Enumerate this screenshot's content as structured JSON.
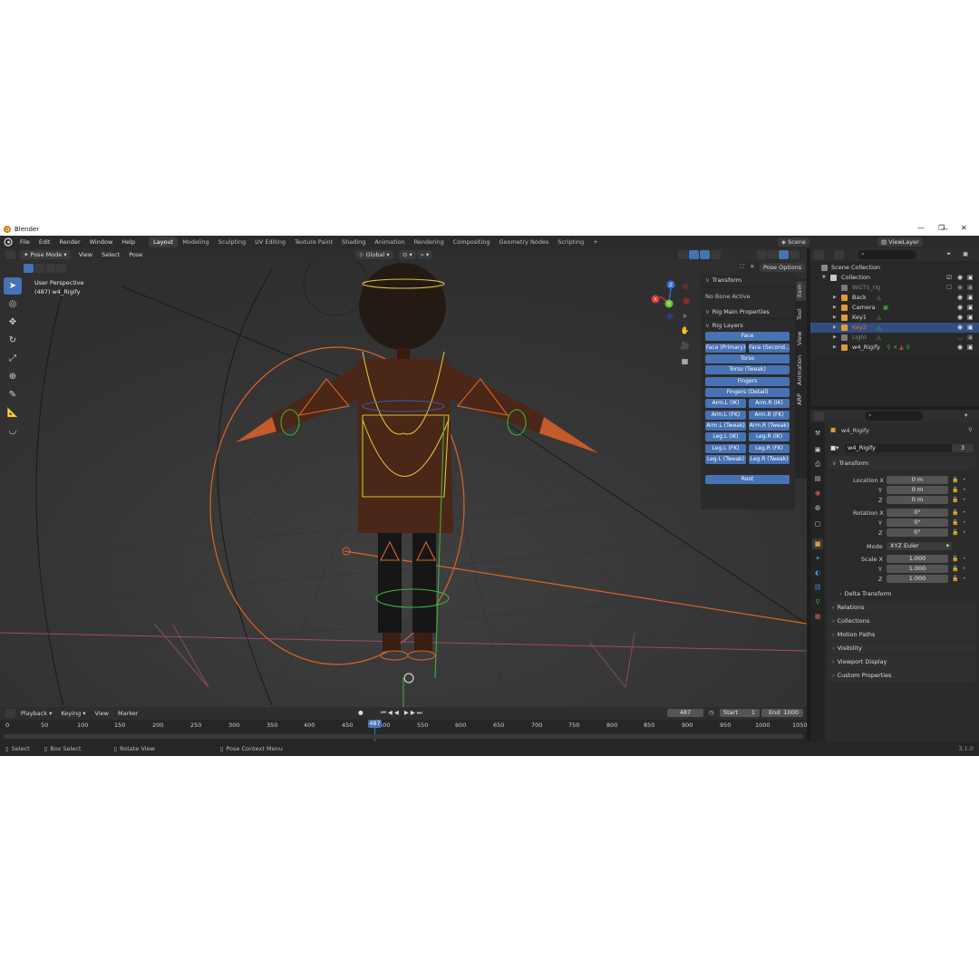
{
  "window": {
    "title": "Blender",
    "minimize": "—",
    "maximize": "❐",
    "close": "✕"
  },
  "menubar": {
    "menus": [
      "File",
      "Edit",
      "Render",
      "Window",
      "Help"
    ],
    "workspaces": [
      "Layout",
      "Modeling",
      "Sculpting",
      "UV Editing",
      "Texture Paint",
      "Shading",
      "Animation",
      "Rendering",
      "Compositing",
      "Geometry Nodes",
      "Scripting"
    ],
    "active_workspace": "Layout",
    "add_tab": "+",
    "scene": "Scene",
    "view_layer": "ViewLayer"
  },
  "viewport_header": {
    "mode": "Pose Mode",
    "menus": [
      "View",
      "Select",
      "Pose"
    ],
    "orientation": "Global",
    "pose_options": "Pose Options"
  },
  "viewport": {
    "perspective": "User Perspective",
    "object_info": "(487) w4_Rigify",
    "gizmo": {
      "x": "X",
      "y": "Y",
      "z": "Z"
    }
  },
  "npanel": {
    "transform_label": "Transform",
    "no_bone": "No Bone Active",
    "rig_main": "Rig Main Properties",
    "rig_layers": "Rig Layers",
    "buttons": {
      "face": "Face",
      "face_primary": "Face (Primary)",
      "face_secondary": "Face (Second...",
      "torso": "Torso",
      "torso_tweak": "Torso (Tweak)",
      "fingers": "Fingers",
      "fingers_detail": "Fingers (Detail)",
      "arm_l_ik": "Arm.L (IK)",
      "arm_r_ik": "Arm.R (IK)",
      "arm_l_fk": "Arm.L (FK)",
      "arm_r_fk": "Arm.R (FK)",
      "arm_l_tweak": "Arm.L (Tweak)",
      "arm_r_tweak": "Arm.R (Tweak)",
      "leg_l_ik": "Leg.L (IK)",
      "leg_r_ik": "Leg.R (IK)",
      "leg_l_fk": "Leg.L (FK)",
      "leg_r_fk": "Leg.R (FK)",
      "leg_l_tweak": "Leg.L (Tweak)",
      "leg_r_tweak": "Leg.R (Tweak)",
      "root": "Root"
    },
    "tabs": [
      "Item",
      "Tool",
      "View",
      "Animation",
      "ARP"
    ]
  },
  "timeline": {
    "menus": [
      "Playback",
      "Keying",
      "View",
      "Marker"
    ],
    "current_frame": "487",
    "start_label": "Start",
    "start": "1",
    "end_label": "End",
    "end": "1000",
    "ticks": [
      "0",
      "50",
      "100",
      "150",
      "200",
      "250",
      "300",
      "350",
      "400",
      "450",
      "500",
      "550",
      "600",
      "650",
      "700",
      "750",
      "800",
      "850",
      "900",
      "950",
      "1000",
      "1050"
    ]
  },
  "statusbar": {
    "select": "Select",
    "box_select": "Box Select",
    "rotate_view": "Rotate View",
    "pose_context": "Pose Context Menu",
    "version": "3.1.0"
  },
  "outliner": {
    "scene_collection": "Scene Collection",
    "rows": [
      {
        "name": "Collection",
        "color": "#c8c8c8"
      },
      {
        "name": "WGTS_rig",
        "color": "#7a7a7a"
      },
      {
        "name": "Back",
        "color": "#e09a3a"
      },
      {
        "name": "Camera",
        "color": "#e09a3a"
      },
      {
        "name": "Key1",
        "color": "#e09a3a"
      },
      {
        "name": "Key2",
        "color": "#e09a3a"
      },
      {
        "name": "Light",
        "color": "#7a7a7a"
      },
      {
        "name": "w4_Rigify",
        "color": "#e09a3a"
      }
    ]
  },
  "properties": {
    "object_name": "w4_Rigify",
    "data_name": "w4_Rigify",
    "users": "3",
    "transform": "Transform",
    "location_x_label": "Location X",
    "location_x": "0 m",
    "location_y": "0 m",
    "location_z": "0 m",
    "rotation_x_label": "Rotation X",
    "rotation_x": "0°",
    "rotation_y": "0°",
    "rotation_z": "0°",
    "mode_label": "Mode",
    "mode": "XYZ Euler",
    "scale_x_label": "Scale X",
    "scale_x": "1.000",
    "scale_y": "1.000",
    "scale_z": "1.000",
    "y_label": "Y",
    "z_label": "Z",
    "delta_transform": "Delta Transform",
    "relations": "Relations",
    "collections": "Collections",
    "motion_paths": "Motion Paths",
    "visibility": "Visibility",
    "viewport_display": "Viewport Display",
    "custom_properties": "Custom Properties"
  },
  "colors": {
    "accent": "#4772b3",
    "bone_orange": "#e0622a",
    "bone_yellow": "#d8c23a",
    "bone_green": "#3fae3a"
  }
}
